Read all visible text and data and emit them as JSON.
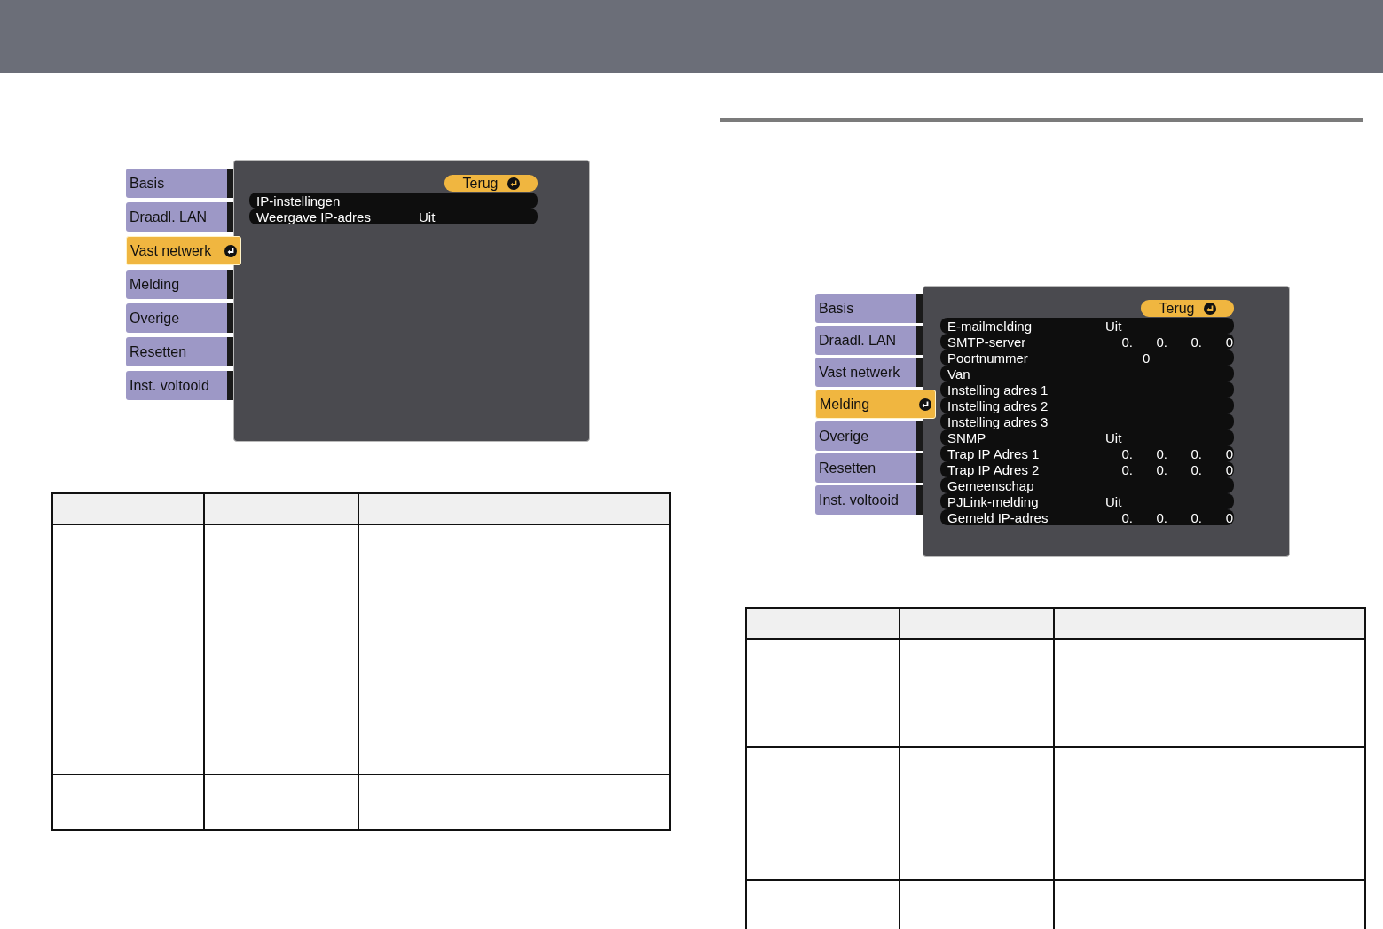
{
  "menus": [
    {
      "tabs": [
        {
          "label": "Basis",
          "selected": false
        },
        {
          "label": "Draadl. LAN",
          "selected": false
        },
        {
          "label": "Vast netwerk",
          "selected": true
        },
        {
          "label": "Melding",
          "selected": false
        },
        {
          "label": "Overige",
          "selected": false
        },
        {
          "label": "Resetten",
          "selected": false
        },
        {
          "label": "Inst. voltooid",
          "selected": false
        }
      ],
      "back_button": "Terug",
      "items": [
        {
          "label": "IP-instellingen",
          "kind": "plain"
        },
        {
          "label": "Weergave IP-adres",
          "kind": "text",
          "value": "Uit"
        }
      ]
    },
    {
      "tabs": [
        {
          "label": "Basis",
          "selected": false
        },
        {
          "label": "Draadl. LAN",
          "selected": false
        },
        {
          "label": "Vast netwerk",
          "selected": false
        },
        {
          "label": "Melding",
          "selected": true
        },
        {
          "label": "Overige",
          "selected": false
        },
        {
          "label": "Resetten",
          "selected": false
        },
        {
          "label": "Inst. voltooid",
          "selected": false
        }
      ],
      "back_button": "Terug",
      "items": [
        {
          "label": "E-mailmelding",
          "kind": "text",
          "value": "Uit"
        },
        {
          "label": "SMTP-server",
          "kind": "ip",
          "octets": [
            "0.",
            "0.",
            "0.",
            "0"
          ]
        },
        {
          "label": "Poortnummer",
          "kind": "number",
          "value": "0"
        },
        {
          "label": "Van",
          "kind": "plain"
        },
        {
          "label": "Instelling adres 1",
          "kind": "plain"
        },
        {
          "label": "Instelling adres 2",
          "kind": "plain"
        },
        {
          "label": "Instelling adres 3",
          "kind": "plain"
        },
        {
          "label": "SNMP",
          "kind": "text",
          "value": "Uit"
        },
        {
          "label": "Trap IP Adres 1",
          "kind": "ip",
          "octets": [
            "0.",
            "0.",
            "0.",
            "0"
          ]
        },
        {
          "label": "Trap IP Adres 2",
          "kind": "ip",
          "octets": [
            "0.",
            "0.",
            "0.",
            "0"
          ]
        },
        {
          "label": "Gemeenschap",
          "kind": "plain"
        },
        {
          "label": "PJLink-melding",
          "kind": "text",
          "value": "Uit"
        },
        {
          "label": "Gemeld IP-adres",
          "kind": "ip",
          "octets": [
            "0.",
            "0.",
            "0.",
            "0"
          ]
        }
      ]
    }
  ]
}
